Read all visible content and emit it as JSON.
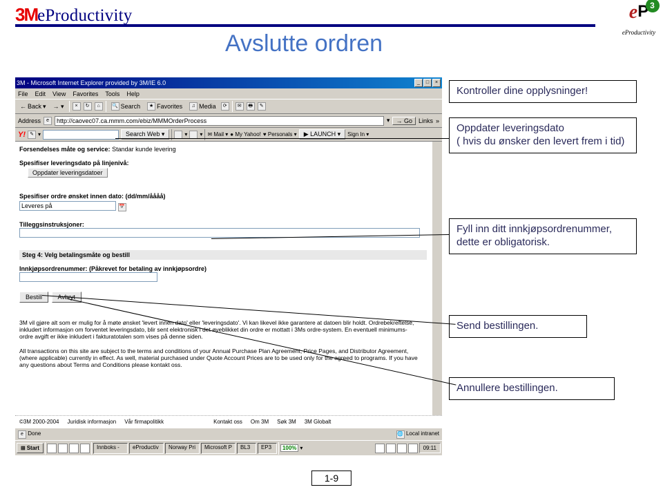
{
  "brand": {
    "m": "3M",
    "eprod": "eProductivity",
    "sub": "eProductivity",
    "badge_e": "e",
    "badge_p": "P",
    "badge_3": "3"
  },
  "page_title": "Avslutte ordren",
  "page_number": "1-9",
  "callouts": {
    "check": "Kontroller dine opplysninger!",
    "date": "Oppdater leveringsdato\n( hvis du ønsker den levert frem i tid)",
    "po": "Fyll inn ditt innkjøpsordrenummer,\ndette er obligatorisk.",
    "send": "Send bestillingen.",
    "cancel": "Annullere bestillingen."
  },
  "window": {
    "title": "3M - Microsoft Internet Explorer provided by 3M/IE 6.0",
    "menu": [
      "File",
      "Edit",
      "View",
      "Favorites",
      "Tools",
      "Help"
    ],
    "toolbar": {
      "back": "Back",
      "search": "Search",
      "favorites": "Favorites",
      "media": "Media"
    },
    "address_label": "Address",
    "url": "http://caovec07.ca.mmm.com/ebiz/MMMOrderProcess",
    "go": "Go",
    "links": "Links",
    "yahoo": {
      "brand": "Y!",
      "searchweb": "Search Web",
      "mail": "Mail",
      "myy": "My Yahoo!",
      "pers": "Personals",
      "launch": "LAUNCH",
      "signin": "Sign In"
    }
  },
  "form": {
    "line1_label": "Forsendelses måte og service:",
    "line1_value": "Standar kunde levering",
    "spec_date": "Spesifiser leveringsdato på linjenivå:",
    "update_dates_btn": "Oppdater leveringsdatoer",
    "date_label": "Spesifiser ordre ønsket innen dato: (dd/mm/åååå)",
    "date_value": "Leveres på",
    "extra_label": "Tilleggsinstruksjoner:",
    "step4": "Steg 4: Velg betalingsmåte og bestill",
    "po_label": "Innkjøpsordrenummer: (Påkrevet for betaling av innkjøpsordre)",
    "order_btn": "Bestill",
    "cancel_btn": "Avbryt",
    "disclaimer1": "3M vil gjøre alt som er mulig for å møte ønsket 'levert innen dato' eller 'leveringsdato'. Vi kan likevel ikke garantere at datoen blir holdt. Ordrebekreftelse, inkludert informasjon om forventet leveringsdato, blir sent elektronisk i det øyeblikket din ordre er mottatt i 3Ms ordre-system. En eventuell minimums-ordre avgift er ikke inkludert i fakturatotalen som vises på denne siden.",
    "disclaimer2": "All transactions on this site are subject to the terms and conditions of your Annual Purchase Plan Agreement, Price Pages, and Distributor Agreement, (where applicable) currently in effect. As well, material purchased under Quote Account Prices are to be used only for the agreed to programs. If you have any questions about Terms and Conditions please kontakt oss."
  },
  "footer": {
    "copyright": "©3M 2000-2004",
    "links": [
      "Juridisk informasjon",
      "Vår firmapolitikk",
      "Kontakt oss",
      "Om 3M",
      "Søk 3M",
      "3M Globalt"
    ]
  },
  "status": {
    "done": "Done",
    "zone": "Local intranet"
  },
  "taskbar": {
    "start": "Start",
    "zoom": "100%",
    "clock": "09:11",
    "apps": [
      "Innboks -",
      "eProductiv",
      "Norway Pri",
      "Microsoft P",
      "BL3",
      "EP3"
    ]
  }
}
